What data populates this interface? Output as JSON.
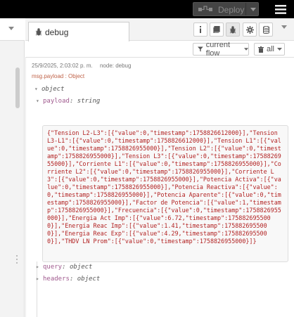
{
  "header": {
    "deploy_label": "Deploy",
    "deploy_icon": "deploy-icon",
    "menu_icon": "hamburger-menu-icon"
  },
  "sidebar": {
    "tab_label": "debug",
    "tab_icon": "bug-icon",
    "buttons": [
      "info-icon",
      "book-icon",
      "bug-icon",
      "gear-icon",
      "database-icon"
    ],
    "filter_label": "current flow",
    "clear_label": "all"
  },
  "message": {
    "timestamp": "25/9/2025, 2:03:02 p. m.",
    "node": "node: debug",
    "path": "msg.payload : Object",
    "root_type": "object",
    "payload_key": "payload",
    "payload_type": "string",
    "payload_value": "{\"Tension L2-L3\":[{\"value\":0,\"timestamp\":1758826612000}],\"Tension L3-L1\":[{\"value\":0,\"timestamp\":1758826612000}],\"Tension L1\":[{\"value\":0,\"timestamp\":1758826955000}],\"Tension L2\":[{\"value\":0,\"timestamp\":1758826955000}],\"Tension L3\":[{\"value\":0,\"timestamp\":1758826955000}],\"Corriente L1\":[{\"value\":0,\"timestamp\":1758826955000}],\"Corriente L2\":[{\"value\":0,\"timestamp\":1758826955000}],\"Corriente L3\":[{\"value\":0,\"timestamp\":1758826955000}],\"Potencia Activa\":[{\"value\":0,\"timestamp\":1758826955000}],\"Potencia Reactiva\":[{\"value\":0,\"timestamp\":1758826955000}],\"Potencia Aparente\":[{\"value\":0,\"timestamp\":1758826955000}],\"Factor de Potencia\":[{\"value\":1,\"timestamp\":1758826955000}],\"Frecuencia\":[{\"value\":0,\"timestamp\":1758826955000}],\"Energia Act Imp\":[{\"value\":6.72,\"timestamp\":1758826955000}],\"Energia Reac Imp\":[{\"value\":1.41,\"timestamp\":1758826955000}],\"Energia Reac Exp\":[{\"value\":4.29,\"timestamp\":1758826955000}],\"THDV LN Prom\":[{\"value\":0,\"timestamp\":1758826955000}]}",
    "query_key": "query",
    "query_type": "object",
    "headers_key": "headers",
    "headers_type": "object"
  },
  "colors": {
    "header_bg": "#000000",
    "deploy_bg": "#444444",
    "payload_text": "#b22222",
    "key_color": "#a05a8e"
  }
}
